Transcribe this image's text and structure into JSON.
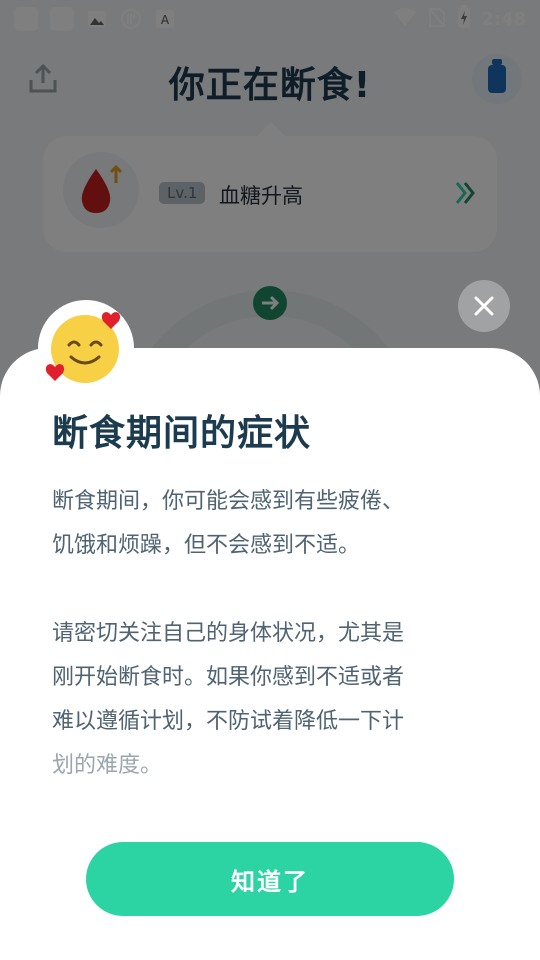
{
  "status_bar": {
    "time": "2:48",
    "notif_letter": "A"
  },
  "header": {
    "title": "你正在断食!"
  },
  "stage_card": {
    "level": "Lv.1",
    "name": "血糖升高"
  },
  "modal": {
    "title": "断食期间的症状",
    "paragraph1": [
      "断食期间，你可能会感到有些疲倦、",
      "饥饿和烦躁，但不会感到不适。"
    ],
    "paragraph2": [
      "请密切关注自己的身体状况，尤其是",
      "刚开始断食时。如果你感到不适或者",
      "难以遵循计划，不防试着降低一下计",
      "划的难度。"
    ],
    "button_label": "知道了"
  },
  "colors": {
    "accent": "#2bd4a2",
    "title": "#1d3b4f",
    "body_text": "#4f6372",
    "overlay": "rgba(0,0,0,0.5)"
  }
}
